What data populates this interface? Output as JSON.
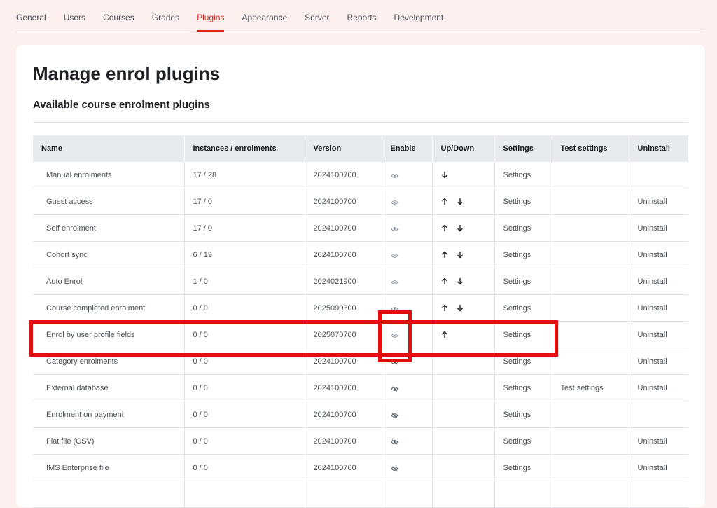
{
  "nav": {
    "tabs": [
      {
        "label": "General"
      },
      {
        "label": "Users"
      },
      {
        "label": "Courses"
      },
      {
        "label": "Grades"
      },
      {
        "label": "Plugins",
        "active": true
      },
      {
        "label": "Appearance"
      },
      {
        "label": "Server"
      },
      {
        "label": "Reports"
      },
      {
        "label": "Development"
      }
    ]
  },
  "page": {
    "title": "Manage enrol plugins",
    "section_title": "Available course enrolment plugins"
  },
  "table": {
    "headers": [
      "Name",
      "Instances / enrolments",
      "Version",
      "Enable",
      "Up/Down",
      "Settings",
      "Test settings",
      "Uninstall"
    ],
    "rows": [
      {
        "name": "Manual enrolments",
        "instances": "17 / 28",
        "version": "2024100700",
        "enabled": true,
        "up": false,
        "down": true,
        "settings": "Settings",
        "test_settings": "",
        "uninstall": ""
      },
      {
        "name": "Guest access",
        "instances": "17 / 0",
        "version": "2024100700",
        "enabled": true,
        "up": true,
        "down": true,
        "settings": "Settings",
        "test_settings": "",
        "uninstall": "Uninstall"
      },
      {
        "name": "Self enrolment",
        "instances": "17 / 0",
        "version": "2024100700",
        "enabled": true,
        "up": true,
        "down": true,
        "settings": "Settings",
        "test_settings": "",
        "uninstall": "Uninstall"
      },
      {
        "name": "Cohort sync",
        "instances": "6 / 19",
        "version": "2024100700",
        "enabled": true,
        "up": true,
        "down": true,
        "settings": "Settings",
        "test_settings": "",
        "uninstall": "Uninstall"
      },
      {
        "name": "Auto Enrol",
        "instances": "1 / 0",
        "version": "2024021900",
        "enabled": true,
        "up": true,
        "down": true,
        "settings": "Settings",
        "test_settings": "",
        "uninstall": "Uninstall"
      },
      {
        "name": "Course completed enrolment",
        "instances": "0 / 0",
        "version": "2025090300",
        "enabled": true,
        "up": true,
        "down": true,
        "settings": "Settings",
        "test_settings": "",
        "uninstall": "Uninstall"
      },
      {
        "name": "Enrol by user profile fields",
        "instances": "0 / 0",
        "version": "2025070700",
        "enabled": true,
        "up": true,
        "down": false,
        "settings": "Settings",
        "test_settings": "",
        "uninstall": "Uninstall"
      },
      {
        "name": "Category enrolments",
        "instances": "0 / 0",
        "version": "2024100700",
        "enabled": false,
        "up": false,
        "down": false,
        "settings": "Settings",
        "test_settings": "",
        "uninstall": "Uninstall"
      },
      {
        "name": "External database",
        "instances": "0 / 0",
        "version": "2024100700",
        "enabled": false,
        "up": false,
        "down": false,
        "settings": "Settings",
        "test_settings": "Test settings",
        "uninstall": "Uninstall"
      },
      {
        "name": "Enrolment on payment",
        "instances": "0 / 0",
        "version": "2024100700",
        "enabled": false,
        "up": false,
        "down": false,
        "settings": "Settings",
        "test_settings": "",
        "uninstall": ""
      },
      {
        "name": "Flat file (CSV)",
        "instances": "0 / 0",
        "version": "2024100700",
        "enabled": false,
        "up": false,
        "down": false,
        "settings": "Settings",
        "test_settings": "",
        "uninstall": "Uninstall"
      },
      {
        "name": "IMS Enterprise file",
        "instances": "0 / 0",
        "version": "2024100700",
        "enabled": false,
        "up": false,
        "down": false,
        "settings": "Settings",
        "test_settings": "",
        "uninstall": "Uninstall"
      },
      {
        "name": "",
        "instances": "",
        "version": "",
        "enabled": null,
        "up": false,
        "down": false,
        "settings": "",
        "test_settings": "",
        "uninstall": ""
      }
    ]
  },
  "colors": {
    "accent": "#e2231a",
    "highlight": "#e10e0e",
    "page_bg": "#fdf0ef",
    "header_bg": "#e7ebef"
  },
  "icons": {
    "enabled": "eye-icon",
    "disabled": "eye-slash-icon",
    "up": "arrow-up-icon",
    "down": "arrow-down-icon"
  }
}
